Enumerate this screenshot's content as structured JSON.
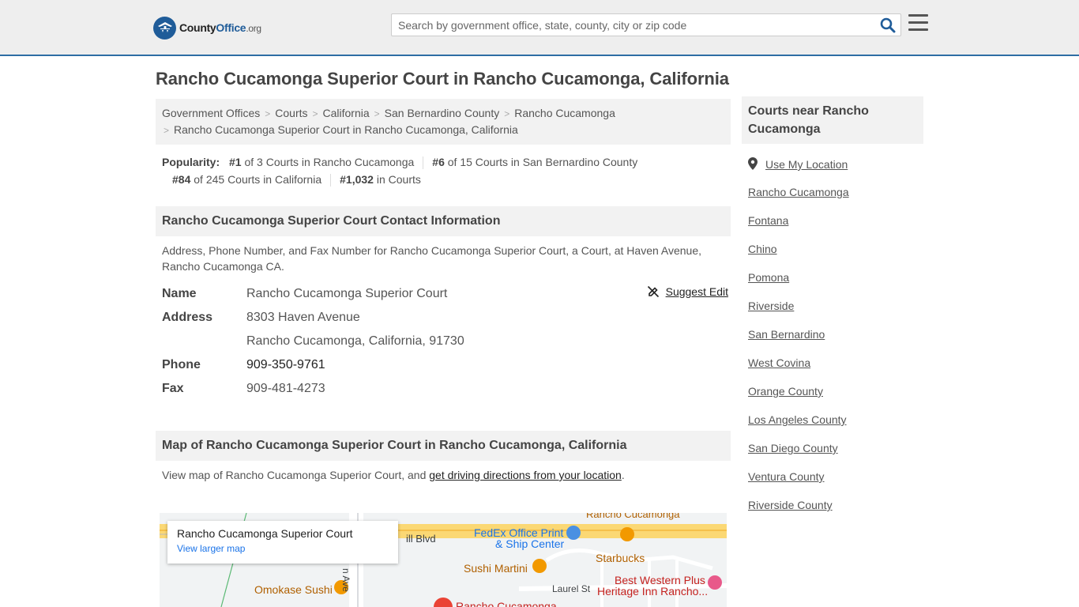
{
  "header": {
    "logo": {
      "county": "County",
      "office": "Office",
      "org": ".org"
    },
    "search_placeholder": "Search by government office, state, county, city or zip code"
  },
  "page_title": "Rancho Cucamonga Superior Court in Rancho Cucamonga, California",
  "breadcrumbs": [
    "Government Offices",
    "Courts",
    "California",
    "San Bernardino County",
    "Rancho Cucamonga",
    "Rancho Cucamonga Superior Court in Rancho Cucamonga, California"
  ],
  "popularity": {
    "label": "Popularity:",
    "items": [
      {
        "rank": "#1",
        "text": "of 3 Courts in Rancho Cucamonga"
      },
      {
        "rank": "#6",
        "text": "of 15 Courts in San Bernardino County"
      },
      {
        "rank": "#84",
        "text": "of 245 Courts in California"
      },
      {
        "rank": "#1,032",
        "text": "in Courts"
      }
    ]
  },
  "contact": {
    "heading": "Rancho Cucamonga Superior Court Contact Information",
    "description": "Address, Phone Number, and Fax Number for Rancho Cucamonga Superior Court, a Court, at Haven Avenue, Rancho Cucamonga CA.",
    "suggest_edit": "Suggest Edit",
    "labels": {
      "name": "Name",
      "address": "Address",
      "phone": "Phone",
      "fax": "Fax"
    },
    "name": "Rancho Cucamonga Superior Court",
    "address_line1": "8303 Haven Avenue",
    "address_line2": "Rancho Cucamonga, California, 91730",
    "phone": "909-350-9761",
    "fax": "909-481-4273"
  },
  "map_section": {
    "heading": "Map of Rancho Cucamonga Superior Court in Rancho Cucamonga, California",
    "desc_prefix": "View map of Rancho Cucamonga Superior Court, and ",
    "desc_link": "get driving directions from your location",
    "desc_suffix": ".",
    "card_title": "Rancho Cucamonga Superior Court",
    "card_link": "View larger map",
    "pois": {
      "fedex": "FedEx Office Print",
      "fedex2": "& Ship Center",
      "starbucks": "Starbucks",
      "sushi_martini": "Sushi Martini",
      "omokase": "Omokase Sushi",
      "best_western": "Best Western Plus",
      "best_western2": "Heritage Inn Rancho...",
      "hill_blvd": "ill Blvd",
      "laurel": "Laurel St",
      "haven_ave": "n Ave",
      "rancho_top": "Rancho Cucamonga",
      "rancho_bottom": "Rancho Cucamonga"
    }
  },
  "sidebar": {
    "heading": "Courts near Rancho Cucamonga",
    "use_location": "Use My Location",
    "links": [
      "Rancho Cucamonga",
      "Fontana",
      "Chino",
      "Pomona",
      "Riverside",
      "San Bernardino",
      "West Covina",
      "Orange County",
      "Los Angeles County",
      "San Diego County",
      "Ventura County",
      "Riverside County"
    ]
  },
  "colors": {
    "accent": "#2e6da4",
    "header_bg": "#eeeeee",
    "section_bg": "#f2f2f2"
  }
}
